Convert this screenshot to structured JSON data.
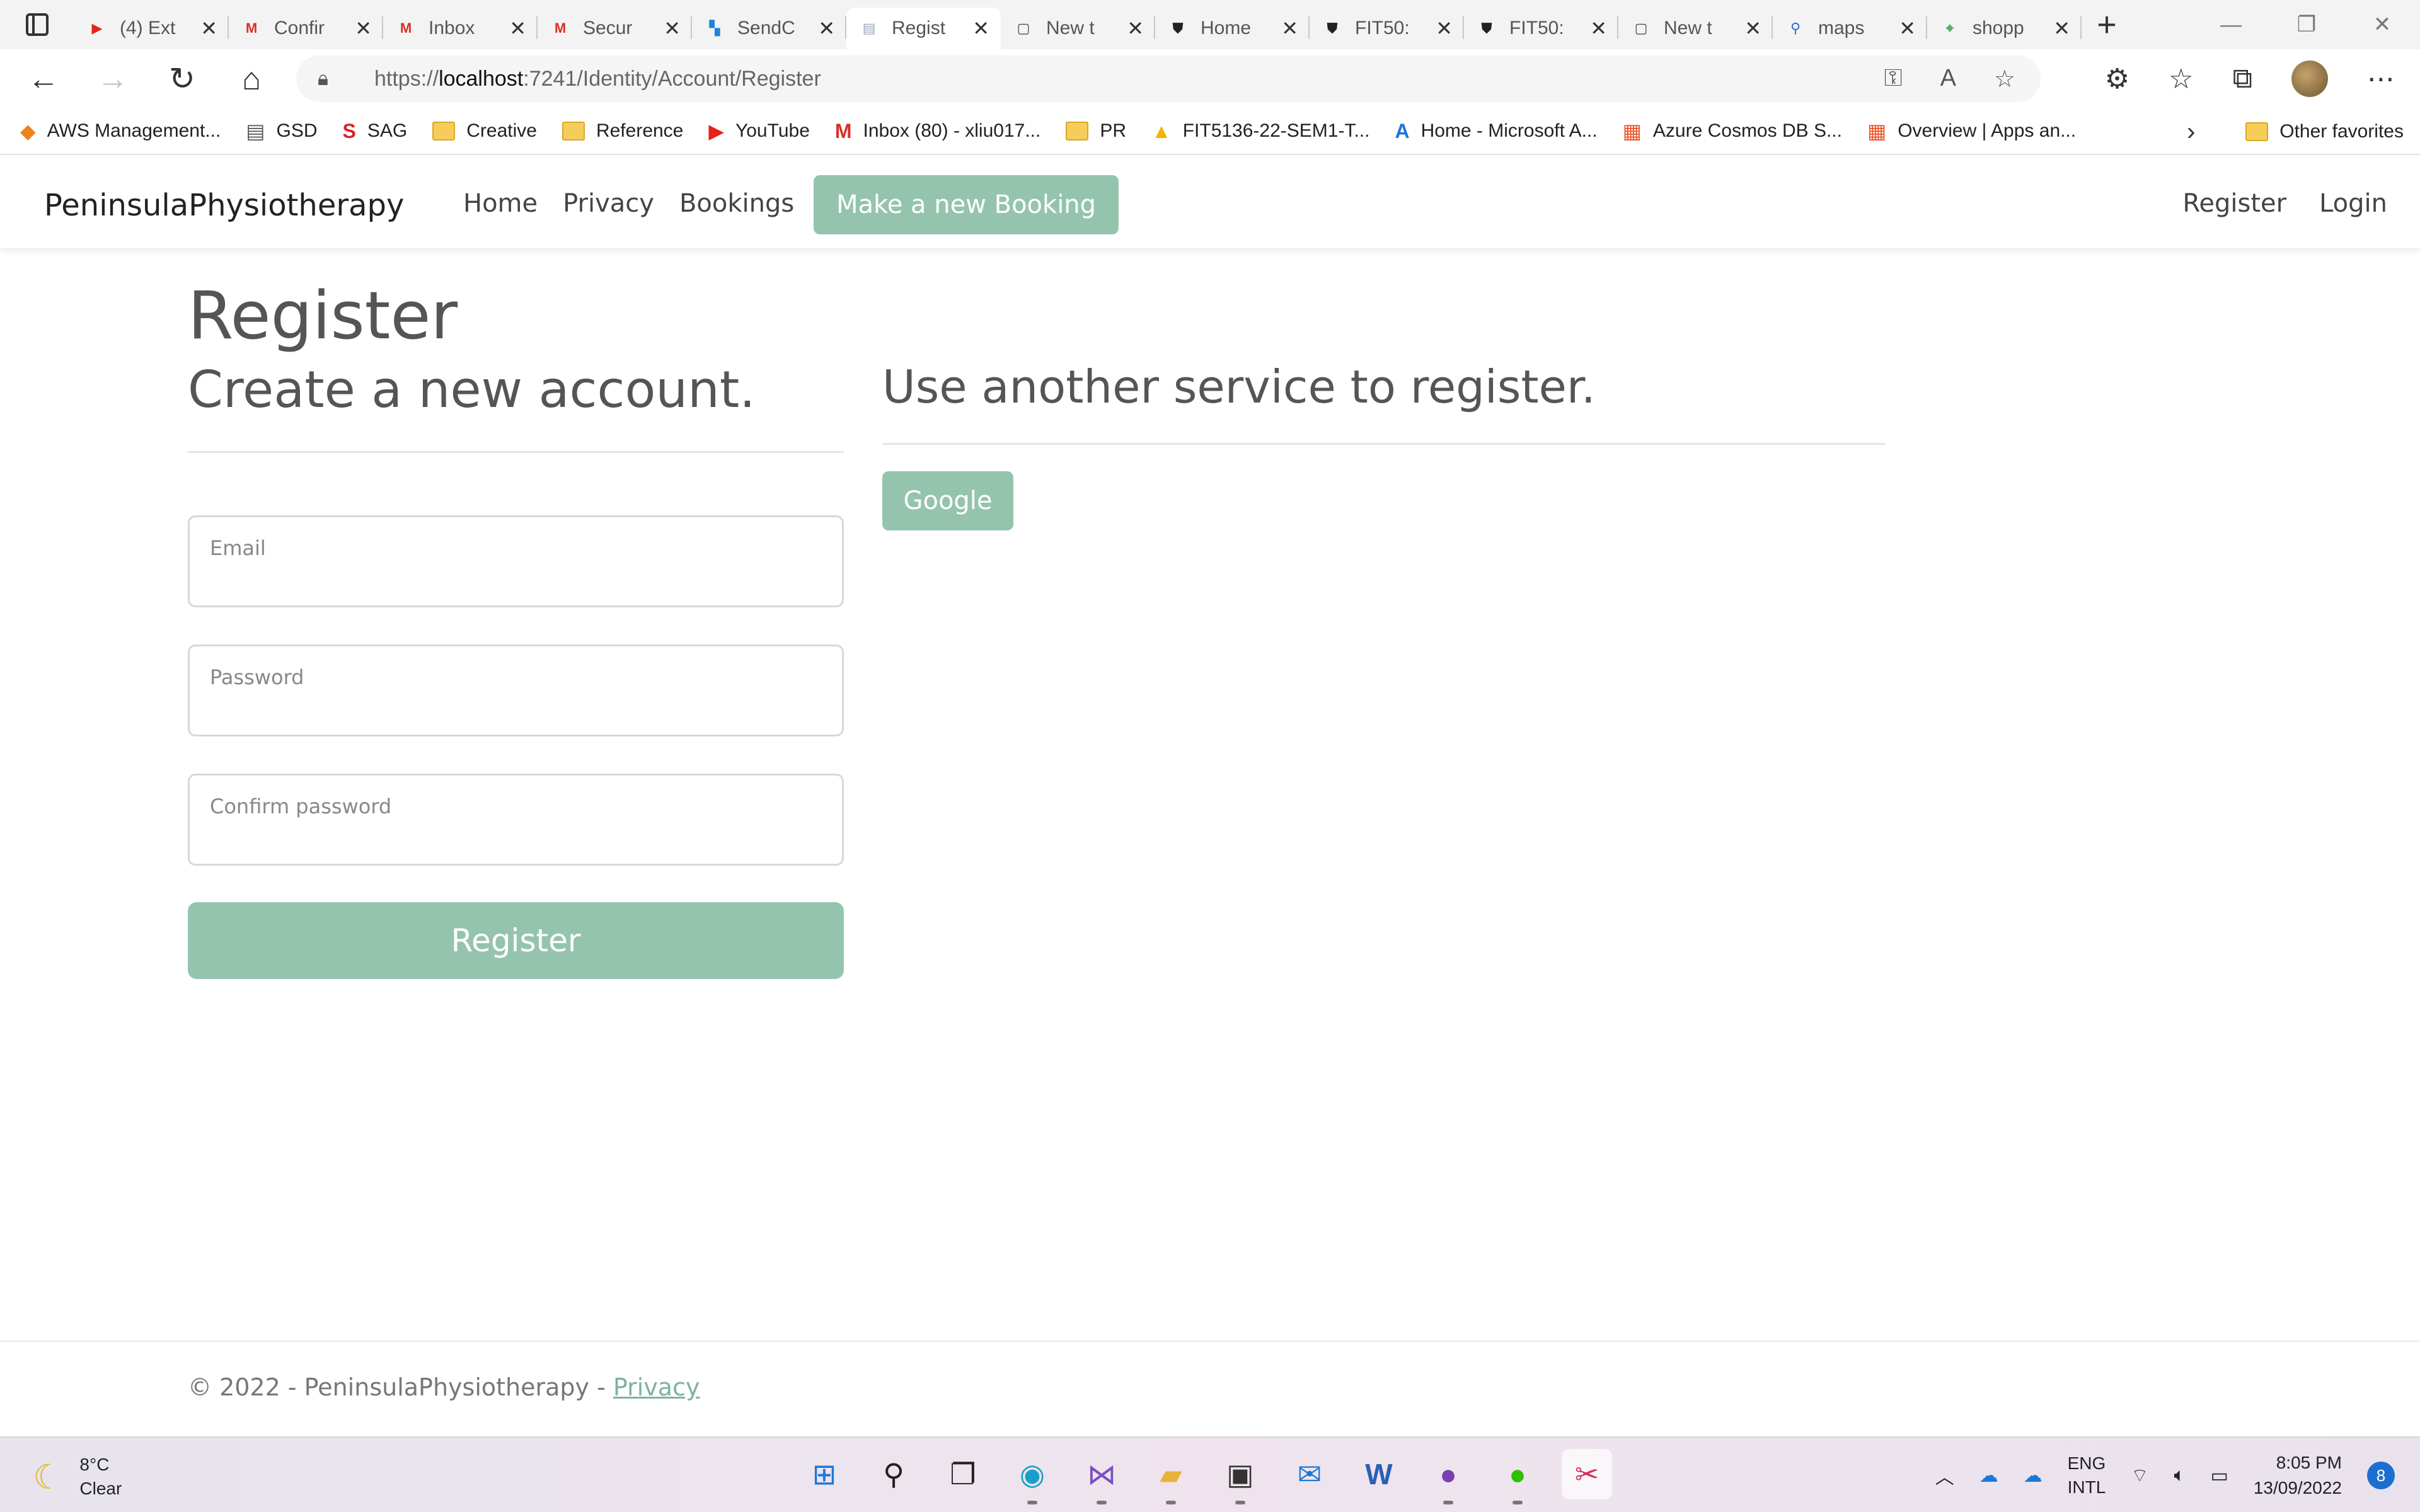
{
  "browser": {
    "tabs": [
      {
        "title": "(4) Ext",
        "icon": "youtube-icon",
        "color": "#e62117"
      },
      {
        "title": "Confir",
        "icon": "gmail-icon",
        "color": "#d93025"
      },
      {
        "title": "Inbox",
        "icon": "gmail-icon",
        "color": "#d93025"
      },
      {
        "title": "Secur",
        "icon": "gmail-icon",
        "color": "#d93025"
      },
      {
        "title": "SendC",
        "icon": "sendgrid-icon",
        "color": "#1a82e2"
      },
      {
        "title": "Regist",
        "icon": "page-icon",
        "color": "#9aa6b8",
        "active": true
      },
      {
        "title": "New t",
        "icon": "newtab-icon",
        "color": "#444444"
      },
      {
        "title": "Home",
        "icon": "monash-shield-icon",
        "color": "#222222"
      },
      {
        "title": "FIT50:",
        "icon": "monash-shield-icon",
        "color": "#222222"
      },
      {
        "title": "FIT50:",
        "icon": "monash-shield-icon",
        "color": "#222222"
      },
      {
        "title": "New t",
        "icon": "newtab-icon",
        "color": "#444444"
      },
      {
        "title": "maps",
        "icon": "search-icon",
        "color": "#2b6ad8"
      },
      {
        "title": "shopp",
        "icon": "maps-pin-icon",
        "color": "#34a853"
      }
    ],
    "url_prefix": "https://",
    "url_host": "localhost",
    "url_rest": ":7241/Identity/Account/Register",
    "bookmarks": [
      {
        "label": "AWS Management...",
        "icon": "aws-icon"
      },
      {
        "label": "GSD",
        "icon": "page-icon"
      },
      {
        "label": "SAG",
        "icon": "sag-icon"
      },
      {
        "label": "Creative",
        "icon": "folder-icon"
      },
      {
        "label": "Reference",
        "icon": "folder-icon"
      },
      {
        "label": "YouTube",
        "icon": "youtube-icon"
      },
      {
        "label": "Inbox (80) - xliu017...",
        "icon": "gmail-icon"
      },
      {
        "label": "PR",
        "icon": "folder-icon"
      },
      {
        "label": "FIT5136-22-SEM1-T...",
        "icon": "drive-icon"
      },
      {
        "label": "Home - Microsoft A...",
        "icon": "azure-icon"
      },
      {
        "label": "Azure Cosmos DB S...",
        "icon": "microsoft-icon"
      },
      {
        "label": "Overview | Apps an...",
        "icon": "microsoft-icon"
      }
    ],
    "other_favorites": "Other favorites"
  },
  "site": {
    "brand": "PeninsulaPhysiotherapy",
    "nav": [
      "Home",
      "Privacy",
      "Bookings"
    ],
    "cta": "Make a new Booking",
    "nav_right": [
      "Register",
      "Login"
    ],
    "accent": "#95c4ae"
  },
  "page": {
    "title": "Register",
    "left_heading": "Create a new account.",
    "right_heading": "Use another service to register.",
    "fields": {
      "email_label": "Email",
      "password_label": "Password",
      "confirm_label": "Confirm password"
    },
    "register_button": "Register",
    "google_button": "Google"
  },
  "footer": {
    "text": "© 2022 - PeninsulaPhysiotherapy - ",
    "privacy": "Privacy"
  },
  "taskbar": {
    "temperature": "8°C",
    "condition": "Clear",
    "lang1": "ENG",
    "lang2": "INTL",
    "time": "8:05 PM",
    "date": "13/09/2022",
    "notifications": "8"
  }
}
